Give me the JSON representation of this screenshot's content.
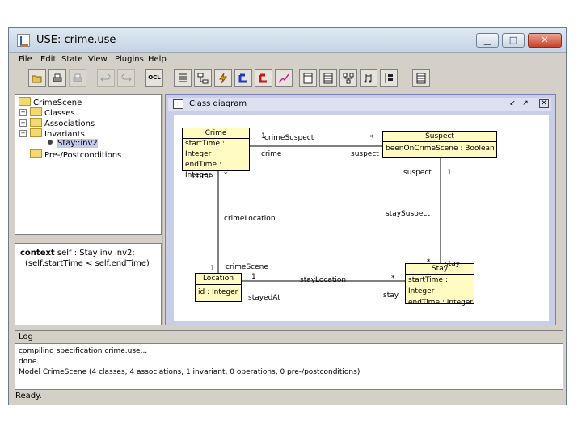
{
  "window": {
    "title": "USE: crime.use"
  },
  "menu": [
    "File",
    "Edit",
    "State",
    "View",
    "Plugins",
    "Help"
  ],
  "toolbar": {
    "ocl_label": "OCL"
  },
  "tree": {
    "root": "CrimeScene",
    "items": [
      {
        "label": "Classes"
      },
      {
        "label": "Associations"
      },
      {
        "label": "Invariants"
      },
      {
        "label": "Stay::inv2"
      },
      {
        "label": "Pre-/Postconditions"
      }
    ]
  },
  "ocl_panel": {
    "keyword": "context",
    "line1_rest": " self : Stay inv inv2:",
    "line2": "(self.startTime < self.endTime)"
  },
  "diagram": {
    "title": "Class diagram",
    "classes": [
      {
        "name": "Crime",
        "attrs": [
          "startTime : Integer",
          "endTime : Integer"
        ]
      },
      {
        "name": "Suspect",
        "attrs": [
          "beenOnCrimeScene : Boolean"
        ]
      },
      {
        "name": "Location",
        "attrs": [
          "id : Integer"
        ]
      },
      {
        "name": "Stay",
        "attrs": [
          "startTime : Integer",
          "endTime : Integer"
        ]
      }
    ],
    "labels": {
      "crime_suspect": "crimeSuspect",
      "mult_1a": "1",
      "mult_star_a": "*",
      "crime_role": "crime",
      "suspect_role": "suspect",
      "crime_role2": "crime",
      "mult_star_b": "*",
      "suspect_role2": "suspect",
      "mult_1b": "1",
      "crime_location": "crimeLocation",
      "stay_suspect": "staySuspect",
      "mult_1c": "1",
      "crime_scene": "crimeScene",
      "mult_star_c": "*",
      "stay_role": "stay",
      "mult_1d": "1",
      "stay_location": "stayLocation",
      "mult_star_d": "*",
      "stayed_at": "stayedAt",
      "stay_role2": "stay"
    }
  },
  "log": {
    "title": "Log",
    "lines": [
      "compiling specification crime.use...",
      "done.",
      "Model CrimeScene (4 classes, 4 associations, 1 invariant, 0 operations, 0 pre-/postconditions)"
    ]
  },
  "status": "Ready.",
  "colors": {
    "class_fill": "#fffbc2",
    "diagram_border": "#7a7fb8",
    "selected_item": "#c5c9ea"
  }
}
